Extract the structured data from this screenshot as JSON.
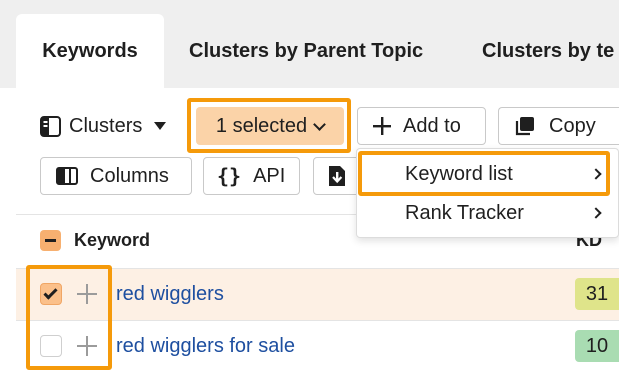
{
  "tabs": [
    {
      "label": "Keywords",
      "active": true
    },
    {
      "label": "Clusters by Parent Topic",
      "active": false
    },
    {
      "label": "Clusters by te",
      "active": false
    }
  ],
  "toolbar": {
    "clusters_label": "Clusters",
    "selected_label": "1 selected",
    "add_to_label": "Add to",
    "copy_label": "Copy",
    "columns_label": "Columns",
    "api_label": "API"
  },
  "dropdown_menu": {
    "items": [
      {
        "label": "Keyword list",
        "highlighted": true
      },
      {
        "label": "Rank Tracker",
        "highlighted": false
      }
    ]
  },
  "table": {
    "columns": [
      "Keyword",
      "KD"
    ],
    "rows": [
      {
        "keyword": "red wigglers",
        "kd": "31",
        "checked": true
      },
      {
        "keyword": "red wigglers for sale",
        "kd": "10",
        "checked": false
      }
    ]
  },
  "colors": {
    "highlight_outline": "#f59a0a",
    "selected_button_bg": "#fbd3a8",
    "selected_row_bg": "#fdf0e4",
    "link": "#1e4fa0",
    "kd_31": "#dfe48a",
    "kd_10": "#a9dcb2"
  },
  "icons": {
    "clusters": "sidebar-panel-icon",
    "add_to": "plus-icon",
    "copy": "copy-icon",
    "columns": "columns-icon",
    "api": "braces-icon",
    "export": "export-file-icon"
  }
}
